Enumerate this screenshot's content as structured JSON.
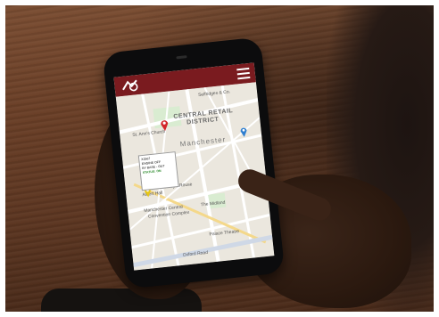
{
  "app": {
    "bar_color": "#7a1b1f",
    "logo_icon": "brand-logo-icon",
    "menu_icon": "hamburger-menu-icon"
  },
  "map": {
    "labels": {
      "selfridges": "Selfridges & Co.",
      "central_retail": "CENTRAL RETAIL",
      "district": "DISTRICT",
      "church": "St. Ann's Church",
      "manchester": "Manchester",
      "albert_hall": "Albert Hall",
      "stoneys": "Stoney's Rouse",
      "convention": "Manchester Central",
      "convention2": "Convention Complex",
      "midland": "The Midland",
      "palace": "Palace Theatre",
      "oxford_rd": "Oxford Road"
    },
    "popup": {
      "line1": "X2567",
      "line2": "ENGINE OFF",
      "line3": "BY BASE - OUT",
      "status": "STATUS: ON"
    },
    "pins": [
      {
        "name": "red-marker-icon",
        "color": "#d3262a"
      },
      {
        "name": "blue-marker-icon",
        "color": "#2f7fd0"
      },
      {
        "name": "yellow-marker-icon",
        "color": "#e6c619"
      }
    ]
  }
}
